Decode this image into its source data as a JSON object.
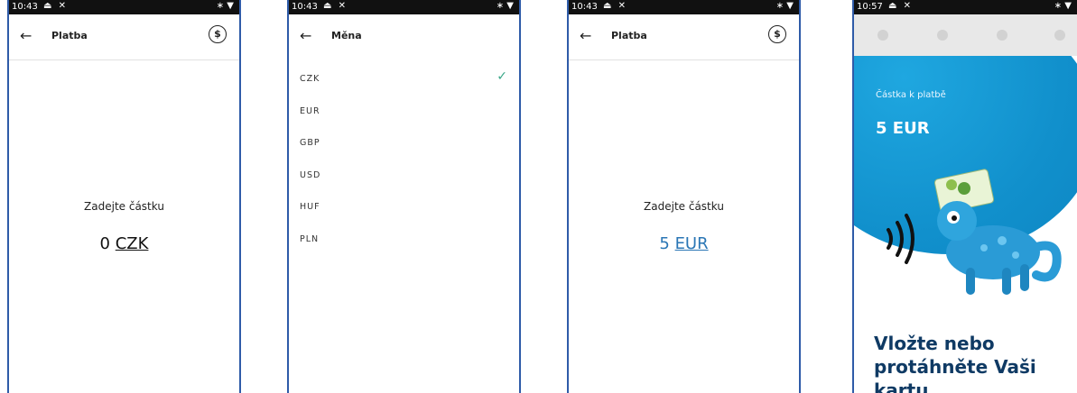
{
  "screen1": {
    "status_time": "10:43",
    "title": "Platba",
    "prompt": "Zadejte částku",
    "amount_value": "0",
    "amount_currency": "CZK"
  },
  "screen2": {
    "status_time": "10:43",
    "title": "Měna",
    "currencies": [
      "CZK",
      "EUR",
      "GBP",
      "USD",
      "HUF",
      "PLN"
    ],
    "selected": "CZK"
  },
  "screen3": {
    "status_time": "10:43",
    "title": "Platba",
    "prompt": "Zadejte částku",
    "amount_value": "5",
    "amount_currency": "EUR"
  },
  "screen4": {
    "status_time": "10:57",
    "amount_label": "Částka k platbě",
    "amount": "5 EUR",
    "instruction_line1": "Vložte nebo",
    "instruction_line2": "protáhněte Vaši kartu"
  },
  "colors": {
    "frame_border": "#2f5ba8",
    "accent_blue": "#2a76b5",
    "check_green": "#3aa788",
    "instruction_text": "#0f3a64",
    "blob_blue": "#1190cc"
  }
}
